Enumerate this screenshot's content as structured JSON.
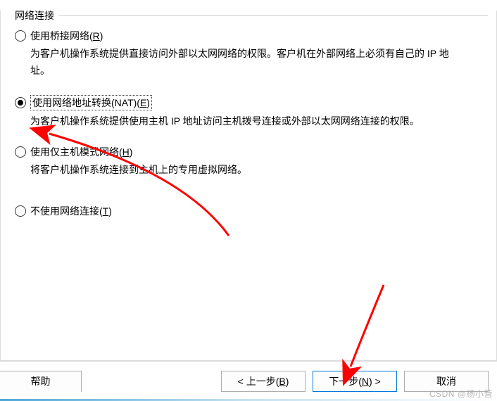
{
  "group": {
    "title": "网络连接"
  },
  "options": {
    "bridge": {
      "label_pre": "使用桥接网络(",
      "label_accel": "R",
      "label_post": ")",
      "desc": "为客户机操作系统提供直接访问外部以太网网络的权限。客户机在外部网络上必须有自己的 IP 地址。",
      "checked": false
    },
    "nat": {
      "label_pre": "使用网络地址转换(NAT)(",
      "label_accel": "E",
      "label_post": ")",
      "desc": "为客户机操作系统提供使用主机 IP 地址访问主机拨号连接或外部以太网网络连接的权限。",
      "checked": true
    },
    "hostonly": {
      "label_pre": "使用仅主机模式网络(",
      "label_accel": "H",
      "label_post": ")",
      "desc": "将客户机操作系统连接到主机上的专用虚拟网络。",
      "checked": false
    },
    "none": {
      "label_pre": "不使用网络连接(",
      "label_accel": "T",
      "label_post": ")",
      "desc": "",
      "checked": false
    }
  },
  "buttons": {
    "help": "帮助",
    "back_pre": "< 上一步(",
    "back_accel": "B",
    "back_post": ")",
    "next_pre": "下一步(",
    "next_accel": "N",
    "next_post": ") >",
    "cancel": "取消"
  },
  "watermark": "CSDN @杨小营"
}
